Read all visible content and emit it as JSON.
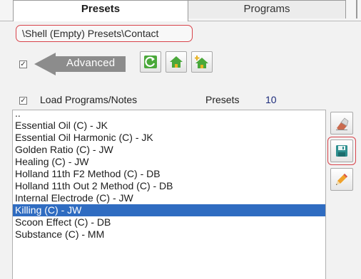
{
  "tabs": [
    {
      "label": "Presets",
      "active": true
    },
    {
      "label": "Programs",
      "active": false
    }
  ],
  "breadcrumb": "\\Shell (Empty) Presets\\Contact",
  "advanced": {
    "checked": true,
    "checkbox_glyph": "✓",
    "label": "Advanced"
  },
  "toolbar": {
    "buttons": [
      {
        "name": "refresh",
        "icon": "refresh-icon"
      },
      {
        "name": "home",
        "icon": "home-icon"
      },
      {
        "name": "home-plus",
        "icon": "home-plus-icon"
      }
    ]
  },
  "load_programs": {
    "checked": true,
    "checkbox_glyph": "✓",
    "label": "Load Programs/Notes"
  },
  "presets_count": {
    "label": "Presets",
    "value": "10"
  },
  "list": {
    "items": [
      "..",
      "Essential Oil (C) - JK",
      "Essential Oil Harmonic (C) - JK",
      "Golden Ratio (C) - JW",
      "Healing (C) - JW",
      "Holland 11th F2 Method (C) - DB",
      "Holland 11th Out 2 Method (C) - DB",
      "Internal Electrode (C) - JW",
      "Killing (C) - JW",
      "Scoon Effect (C) - DB",
      "Substance (C) - MM"
    ],
    "selected_index": 8
  },
  "side_buttons": [
    {
      "name": "clear",
      "icon": "eraser-icon"
    },
    {
      "name": "save",
      "icon": "floppy-disk-icon"
    },
    {
      "name": "edit",
      "icon": "pencil-icon"
    }
  ],
  "colors": {
    "selection": "#2f6cc1",
    "highlight_outline": "#d8434a",
    "icon_green": "#4aa83a",
    "arrow_gray": "#8c8c8c"
  }
}
